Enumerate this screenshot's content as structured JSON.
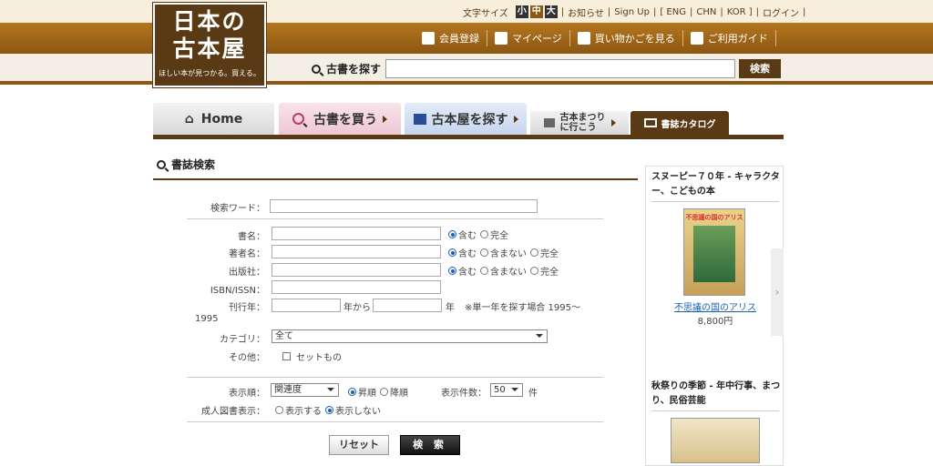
{
  "header": {
    "logo_line1": "日本の",
    "logo_line2": "古本屋",
    "logo_tagline": "ほしい本が見つかる。買える。",
    "font_size_label": "文字サイズ",
    "font_sizes": [
      "小",
      "中",
      "大"
    ],
    "top_links": [
      "お知らせ",
      "Sign Up",
      "ENG",
      "CHN",
      "KOR",
      "ログイン"
    ],
    "nav_links": [
      "会員登録",
      "マイページ",
      "買い物かごを見る",
      "ご利用ガイド"
    ],
    "search_label": "古書を探す",
    "search_button": "検索"
  },
  "tabs": {
    "home": "Home",
    "buy": "古書を買う",
    "shop": "古本屋を探す",
    "fest_line1": "古本まつり",
    "fest_line2": "に行こう",
    "catalog": "書誌カタログ"
  },
  "form": {
    "title": "書誌検索",
    "keyword_label": "検索ワード：",
    "title_label": "書名：",
    "author_label": "著者名：",
    "publisher_label": "出版社：",
    "isbn_label": "ISBN/ISSN：",
    "year_label": "刊行年：",
    "year_from": "年から",
    "year_to": "年",
    "year_note": "※単一年を探す場合 1995～",
    "year_note2": "1995",
    "category_label": "カテゴリ：",
    "category_value": "全て",
    "other_label": "その他：",
    "set_label": "セットもの",
    "opt_include": "含む",
    "opt_exact": "完全",
    "opt_exclude": "含まない",
    "sort_label": "表示順：",
    "sort_value": "関連度",
    "opt_asc": "昇順",
    "opt_desc": "降順",
    "count_label": "表示件数：",
    "count_value": "50",
    "count_unit": "件",
    "adult_label": "成人図書表示：",
    "adult_show": "表示する",
    "adult_hide": "表示しない",
    "reset_button": "リセット",
    "search_button": "検 索"
  },
  "sidebar": {
    "item1_title": "スヌーピー７０年 - キャラクター、こどもの本",
    "item1_cover_text": "不思議の国のアリス",
    "item1_link": "不思議の国のアリス",
    "item1_price": "8,800円",
    "item2_title": "秋祭りの季節 - 年中行事、まつり、民俗芸能"
  }
}
